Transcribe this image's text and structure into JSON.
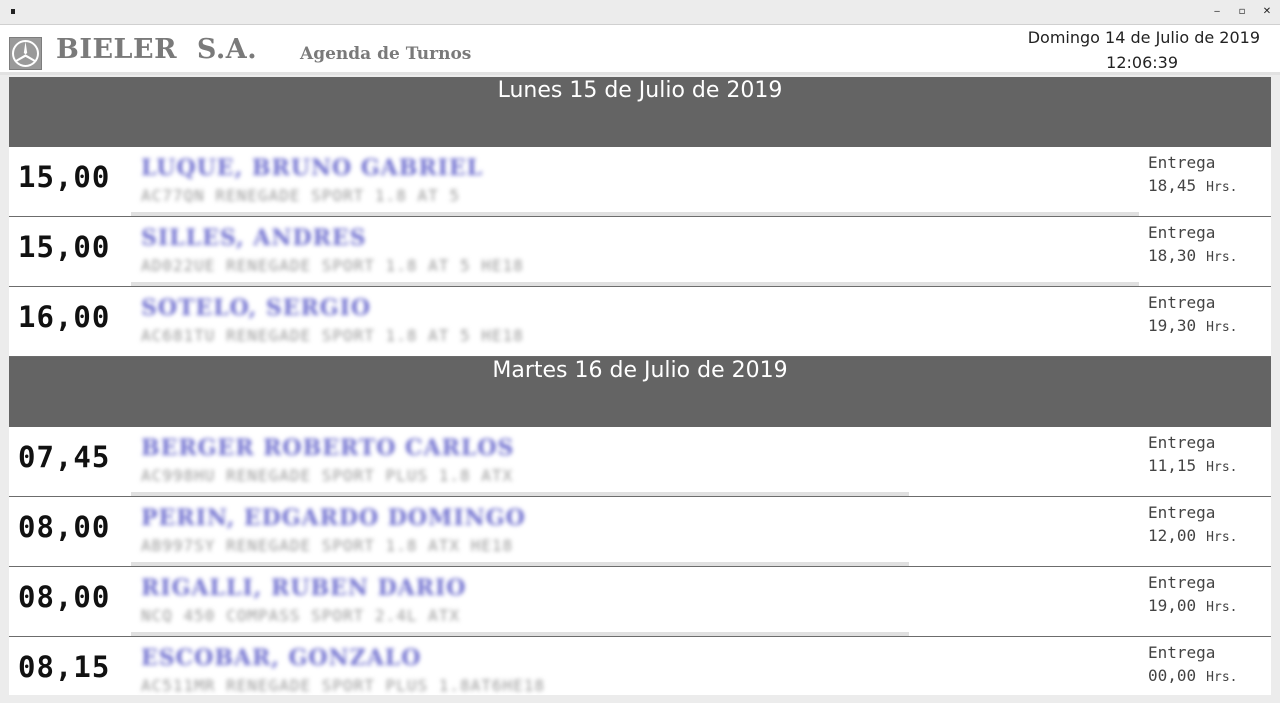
{
  "window": {
    "minimize": "‒",
    "maximize": "▫",
    "close": "✕"
  },
  "header": {
    "company": "BIELER  S.A.",
    "subtitle": "Agenda de Turnos",
    "current_date": "Domingo 14 de Julio de 2019",
    "current_time": "12:06:39"
  },
  "days": [
    {
      "title": "Lunes 15 de Julio de 2019",
      "appointments": [
        {
          "time": "15,00",
          "client": "LUQUE, BRUNO GABRIEL",
          "vehicle": "AC77QN  RENEGADE SPORT 1.8 AT 5",
          "delivery_label": "Entrega",
          "delivery_time": "18,45",
          "delivery_unit": "Hrs."
        },
        {
          "time": "15,00",
          "client": "SILLES, ANDRES",
          "vehicle": "AD022UE  RENEGADE SPORT 1.8 AT 5 HE18",
          "delivery_label": "Entrega",
          "delivery_time": "18,30",
          "delivery_unit": "Hrs."
        },
        {
          "time": "16,00",
          "client": "SOTELO, SERGIO",
          "vehicle": "AC681TU  RENEGADE SPORT 1.8 AT 5 HE18",
          "delivery_label": "Entrega",
          "delivery_time": "19,30",
          "delivery_unit": "Hrs."
        }
      ]
    },
    {
      "title": "Martes 16 de Julio de 2019",
      "appointments": [
        {
          "time": "07,45",
          "client": "BERGER ROBERTO CARLOS",
          "vehicle": "AC998HU  RENEGADE SPORT PLUS 1.8 ATX",
          "delivery_label": "Entrega",
          "delivery_time": "11,15",
          "delivery_unit": "Hrs."
        },
        {
          "time": "08,00",
          "client": "PERIN, EDGARDO DOMINGO",
          "vehicle": "AB997SY  RENEGADE SPORT 1.8 ATX HE18",
          "delivery_label": "Entrega",
          "delivery_time": "12,00",
          "delivery_unit": "Hrs."
        },
        {
          "time": "08,00",
          "client": "RIGALLI, RUBEN DARIO",
          "vehicle": "NCQ 450  COMPASS SPORT 2.4L ATX",
          "delivery_label": "Entrega",
          "delivery_time": "19,00",
          "delivery_unit": "Hrs."
        },
        {
          "time": "08,15",
          "client": "ESCOBAR, GONZALO",
          "vehicle": "AC511MR  RENEGADE SPORT PLUS 1.8AT6HE18",
          "delivery_label": "Entrega",
          "delivery_time": "00,00",
          "delivery_unit": "Hrs."
        }
      ]
    }
  ]
}
